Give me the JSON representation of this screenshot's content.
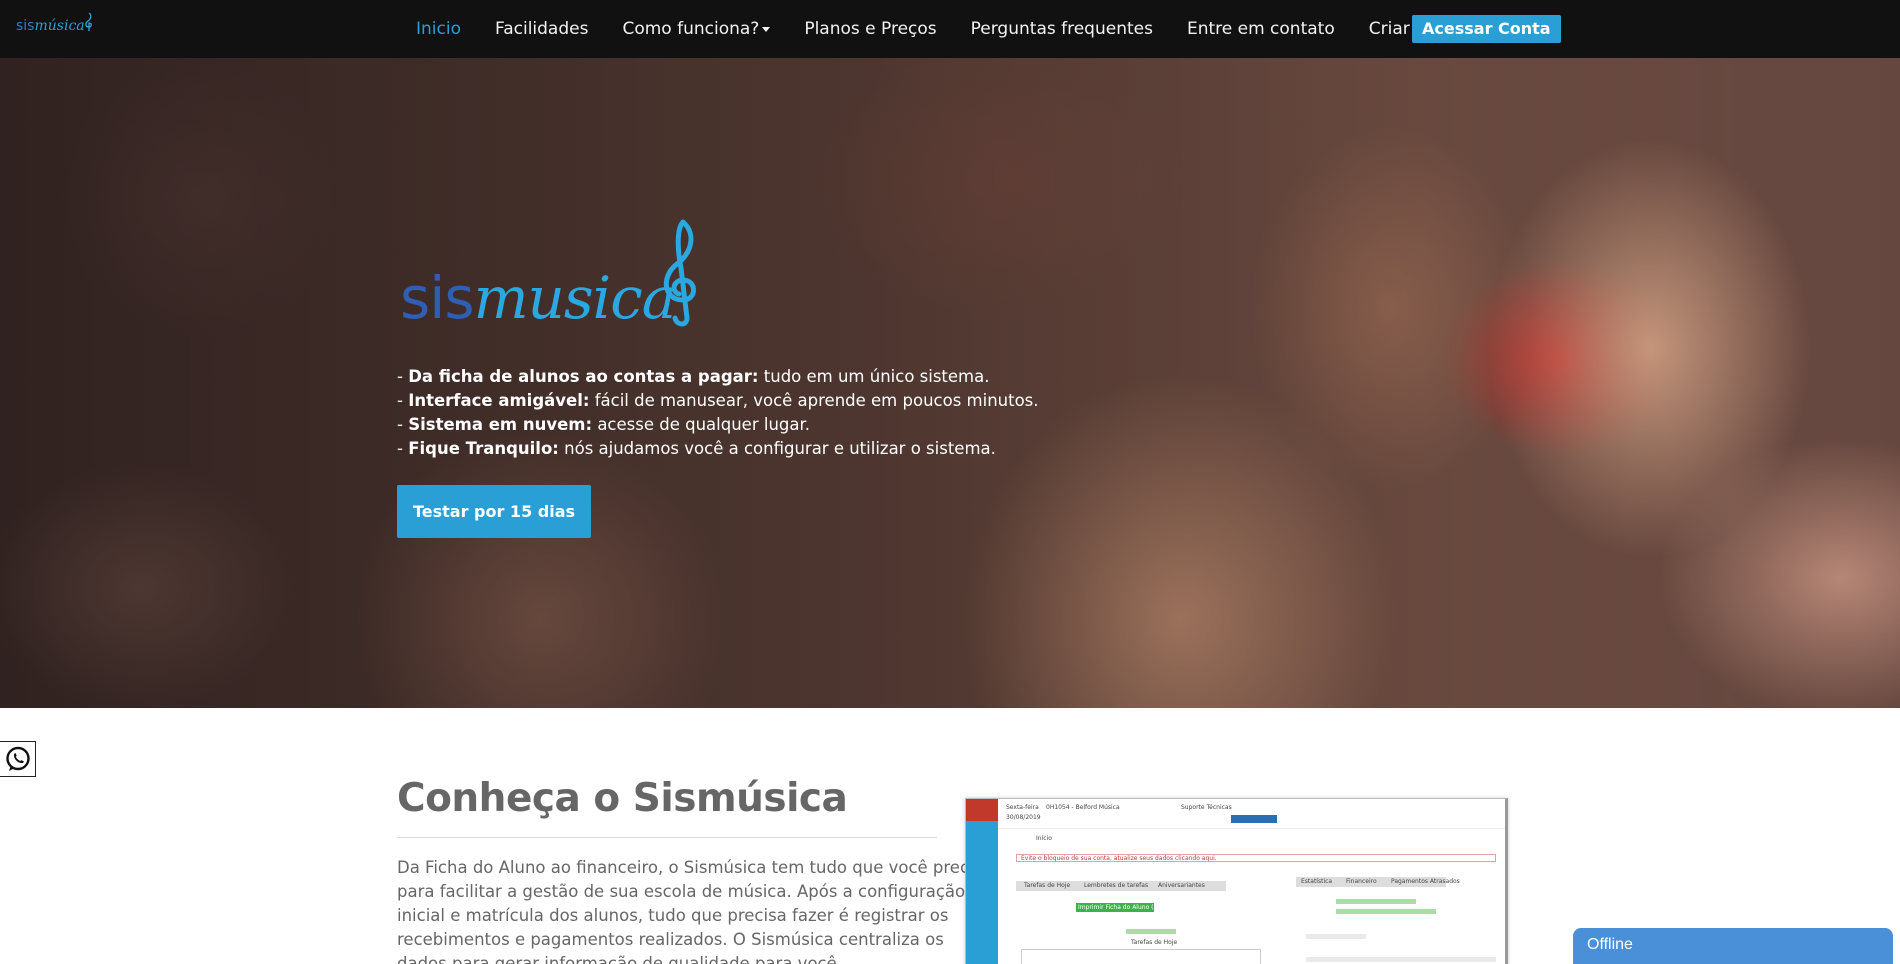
{
  "brand": {
    "part1": "sis",
    "part2": "música"
  },
  "nav": {
    "items": [
      {
        "label": "Inicio",
        "active": true
      },
      {
        "label": "Facilidades"
      },
      {
        "label": "Como funciona?",
        "dropdown": true
      },
      {
        "label": "Planos e Preços"
      },
      {
        "label": "Perguntas frequentes"
      },
      {
        "label": "Entre em contato"
      },
      {
        "label": "Criar Conta"
      }
    ],
    "cta": "Acessar Conta"
  },
  "hero": {
    "logo_part1": "sis",
    "logo_part2": "musica",
    "features": [
      {
        "bold": "Da ficha de alunos ao contas a pagar:",
        "text": " tudo em um único sistema."
      },
      {
        "bold": "Interface amigável:",
        "text": " fácil de manusear, você aprende em poucos minutos."
      },
      {
        "bold": "Sistema em nuvem:",
        "text": " acesse de qualquer lugar."
      },
      {
        "bold": "Fique Tranquilo:",
        "text": " nós ajudamos você a configurar e utilizar o sistema."
      }
    ],
    "button": "Testar por 15 dias"
  },
  "section": {
    "title": "Conheça o Sismúsica",
    "lines": [
      "Da Ficha do Aluno ao financeiro, o Sismúsica tem tudo que você precisa",
      "para facilitar a gestão de sua escola de música. Após a configuração",
      "inicial e matrícula dos alunos, tudo que precisa fazer é registrar os",
      "recebimentos e pagamentos realizados. O Sismúsica centraliza os",
      "dados para gerar informação de qualidade para você."
    ]
  },
  "mock": {
    "day": "Sexta-feira",
    "date": "30/08/2019",
    "school": "0H1054 - Belford Música",
    "support": "Suporte Técnicas",
    "alert": "Evite o bloqueio de sua conta, atualize seus dados clicando aqui.",
    "tab1": "Tarefas de Hoje",
    "tab2": "Lembretes de tarefas",
    "tab3": "Aniversariantes",
    "green_button": "Imprimir Ficha do Aluno (branco)",
    "right_tab1": "Estatística",
    "right_tab2": "Financeiro",
    "right_tab3": "Pagamentos Atrasados",
    "table_title": "Tarefas de Hoje",
    "start": "Início"
  },
  "chat": {
    "status": "Offline"
  },
  "colors": {
    "accent": "#2a9fd6",
    "navbar": "#111111",
    "logo_dark": "#2f5fb5",
    "logo_light": "#2aa8e2"
  },
  "icons": {
    "whatsapp": "whatsapp-icon",
    "caret": "chevron-down-icon",
    "clef": "treble-clef-icon"
  }
}
